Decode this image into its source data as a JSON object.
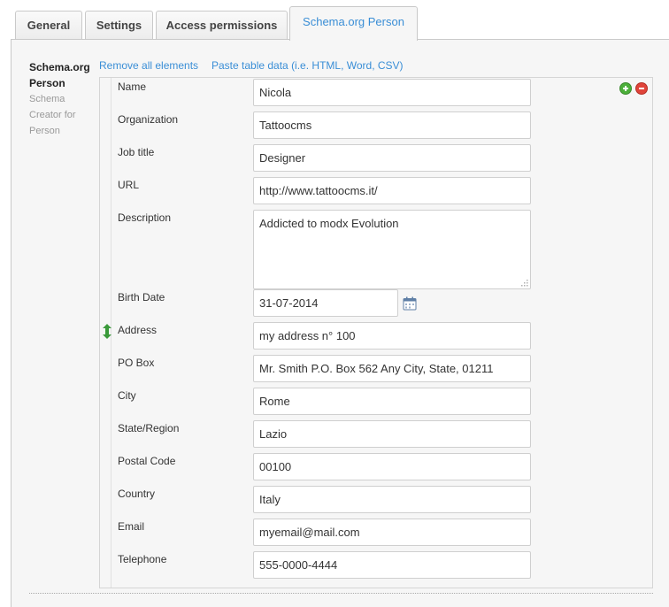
{
  "tabs": [
    {
      "label": "General"
    },
    {
      "label": "Settings"
    },
    {
      "label": "Access permissions"
    },
    {
      "label": "Schema.org Person"
    }
  ],
  "section": {
    "title": "Schema.org Person",
    "description": "Schema Creator for Person"
  },
  "actions": {
    "remove_all": "Remove all elements",
    "paste": "Paste table data (i.e. HTML, Word, CSV)"
  },
  "fields": {
    "name": {
      "label": "Name",
      "value": "Nicola"
    },
    "organization": {
      "label": "Organization",
      "value": "Tattoocms"
    },
    "job_title": {
      "label": "Job title",
      "value": "Designer"
    },
    "url": {
      "label": "URL",
      "value": "http://www.tattoocms.it/"
    },
    "description": {
      "label": "Description",
      "value": "Addicted to modx Evolution"
    },
    "birth_date": {
      "label": "Birth Date",
      "value": "31-07-2014"
    },
    "address": {
      "label": "Address",
      "value": "my address n° 100"
    },
    "po_box": {
      "label": "PO Box",
      "value": "Mr. Smith P.O. Box 562 Any City, State, 01211"
    },
    "city": {
      "label": "City",
      "value": "Rome"
    },
    "state": {
      "label": "State/Region",
      "value": "Lazio"
    },
    "postal_code": {
      "label": "Postal Code",
      "value": "00100"
    },
    "country": {
      "label": "Country",
      "value": "Italy"
    },
    "email": {
      "label": "Email",
      "value": "myemail@mail.com"
    },
    "telephone": {
      "label": "Telephone",
      "value": "555-0000-4444"
    }
  },
  "colors": {
    "link": "#3a8ed6",
    "add": "#4caf3a",
    "remove": "#e0443a",
    "move_arrow": "#3a9a3a"
  },
  "icons": [
    "calendar-icon",
    "add-row-icon",
    "remove-row-icon",
    "move-row-icon"
  ]
}
